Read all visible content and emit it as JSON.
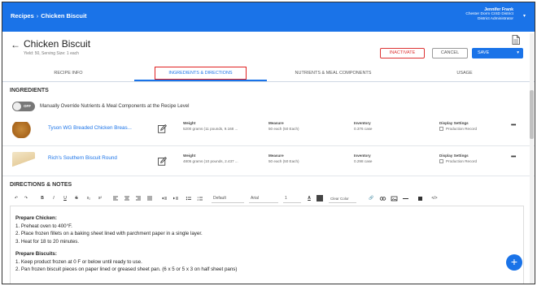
{
  "header": {
    "breadcrumb_root": "Recipes",
    "breadcrumb_sep": "›",
    "breadcrumb_current": "Chicken Biscuit",
    "user_name": "Jennifer Frank",
    "user_org": "Chester Dorm CISD District",
    "user_role": "District Administrator",
    "user_caret": "▾"
  },
  "page": {
    "back_arrow": "←",
    "title": "Chicken Biscuit",
    "subtitle": "Yield: 50, Serving Size: 1 each",
    "doc_icon": "document-icon"
  },
  "actions": {
    "inactivate": "INACTIVATE",
    "cancel": "CANCEL",
    "save": "SAVE",
    "save_caret": "▾"
  },
  "tabs": [
    "RECIPE INFO",
    "INGREDIENTS & DIRECTIONS",
    "NUTRIENTS & MEAL COMPONENTS",
    "USAGE"
  ],
  "active_tab": "INGREDIENTS & DIRECTIONS",
  "ingredients": {
    "heading": "INGREDIENTS",
    "toggle_state": "OFF",
    "override_label": "Manually Override Nutrients & Meal Components at the Recipe Level",
    "labels": {
      "weight": "Weight",
      "measure": "Measure",
      "inventory": "Inventory",
      "display": "Display Settings",
      "production": "Production Record"
    },
    "items": [
      {
        "name": "Tyson WG Breaded Chicken Breas...",
        "weight": "5200 grams (11 pounds, 9.168 ...",
        "measure": "50 each (50 Each)",
        "inventory": "0.376 case",
        "more": "•••"
      },
      {
        "name": "Rich's Southern Biscuit Round",
        "weight": "4805 grams (10 pounds, 2.437 ...",
        "measure": "50 each (50 Each)",
        "inventory": "0.298 case",
        "more": "•••"
      }
    ]
  },
  "directions": {
    "heading": "DIRECTIONS & NOTES",
    "toolbar": {
      "undo": "↶",
      "redo": "↷",
      "bold": "B",
      "italic": "I",
      "underline": "U",
      "strike": "S",
      "sub": "x₂",
      "sup": "x²",
      "font_size": "Default",
      "font_family": "Arial",
      "line_height": "1",
      "text_color": "A",
      "clear": "Clear Color",
      "link": "🔗",
      "code": "</>"
    },
    "body": [
      {
        "text": "Prepare Chicken:",
        "bold": true
      },
      {
        "text": "1. Preheat oven to 400°F."
      },
      {
        "text": "2. Place frozen fillets on a baking sheet lined with parchment paper in a single layer."
      },
      {
        "text": "3. Heat for 18 to 20 minutes."
      },
      {
        "text": "",
        "gap": true
      },
      {
        "text": "Prepare Biscuits:",
        "bold": true
      },
      {
        "text": "1. Keep product frozen at 0 F or below until ready to use."
      },
      {
        "text": "2. Pan frozen biscuit pieces on paper lined or greased sheet pan. (6 x 5 or 5 x 3 on half sheet pans)"
      }
    ],
    "fab": "+"
  },
  "colors": {
    "primary": "#1a73e8",
    "danger": "#d33333",
    "highlight_box": "#e02020"
  }
}
